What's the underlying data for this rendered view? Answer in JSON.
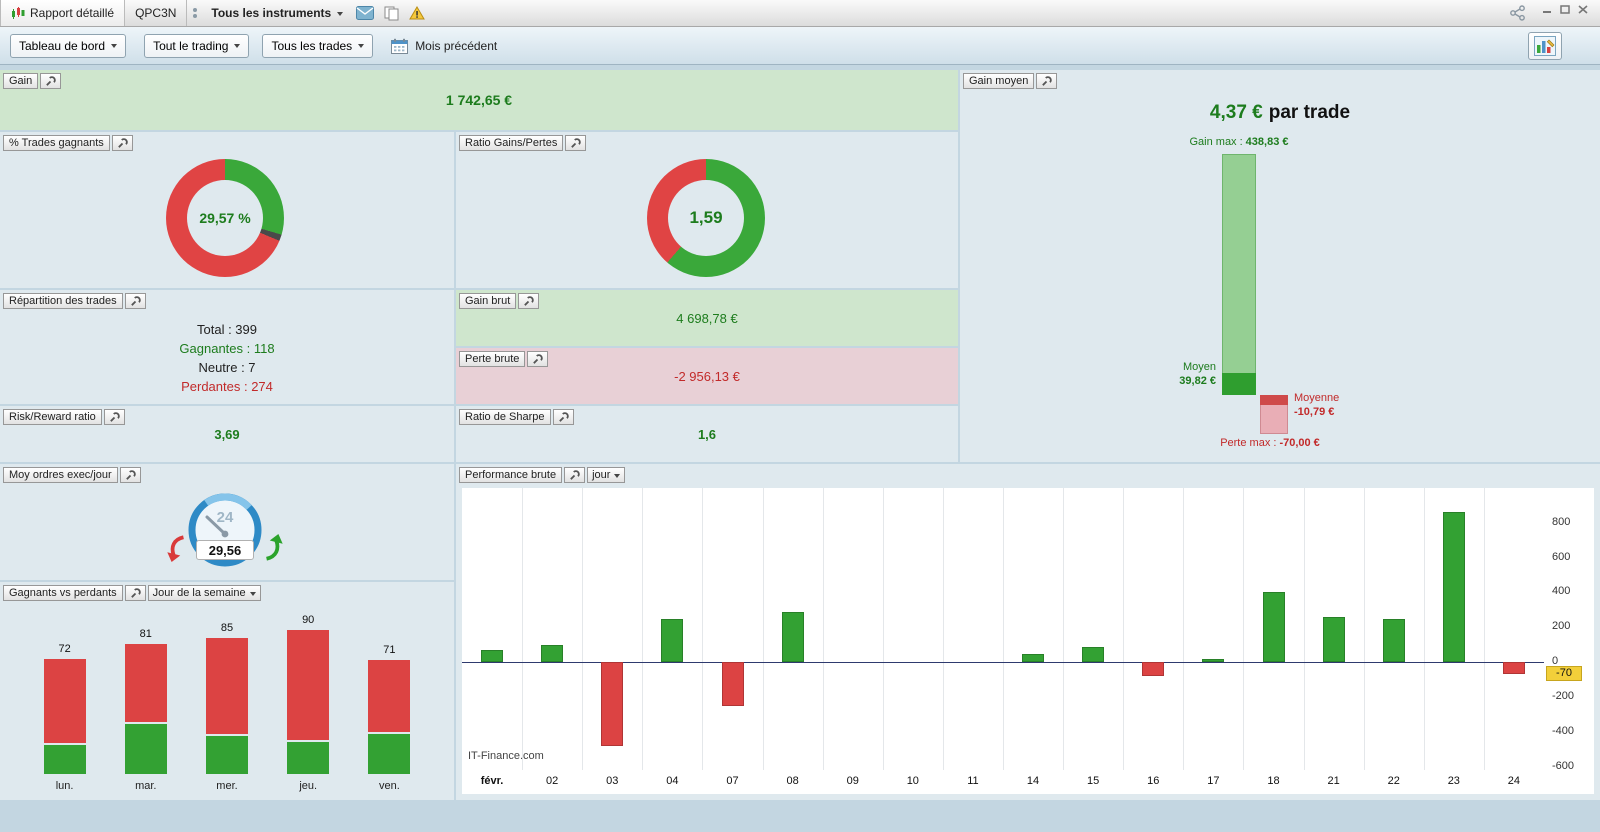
{
  "window": {
    "tabs": [
      {
        "label": "Rapport détaillé"
      },
      {
        "label": "QPC3N"
      }
    ],
    "instruments_dropdown": "Tous les instruments"
  },
  "toolbar": {
    "dashboard_dropdown": "Tableau de bord",
    "trading_scope_dropdown": "Tout le trading",
    "trades_filter_dropdown": "Tous les trades",
    "period_label": "Mois précédent"
  },
  "colors": {
    "text_green": "#1d7c1d",
    "text_red": "#c22a2a",
    "donut_green": "#3aa83a",
    "donut_red": "#e04444",
    "bar_green": "#33a133",
    "bar_red": "#dc4343",
    "panel_green_bg": "#cfe6cd",
    "panel_pink_bg": "#e8d0d6",
    "last_value_tag_bg": "#f2cf3a"
  },
  "panels": {
    "gain": {
      "label": "Gain",
      "value": "1 742,65 €"
    },
    "pct_trades_gagnants": {
      "label": "% Trades gagnants",
      "value": "29,57 %"
    },
    "ratio_gains_pertes": {
      "label": "Ratio Gains/Pertes",
      "value": "1,59"
    },
    "repartition_trades": {
      "label": "Répartition des trades",
      "rows": [
        {
          "name": "Total",
          "value": 399,
          "display": "Total : 399"
        },
        {
          "name": "Gagnantes",
          "value": 118,
          "display": "Gagnantes : 118"
        },
        {
          "name": "Neutre",
          "value": 7,
          "display": "Neutre : 7"
        },
        {
          "name": "Perdantes",
          "value": 274,
          "display": "Perdantes : 274"
        }
      ]
    },
    "gain_brut": {
      "label": "Gain brut",
      "value": "4 698,78 €"
    },
    "perte_brute": {
      "label": "Perte brute",
      "value": "-2 956,13 €"
    },
    "risk_reward": {
      "label": "Risk/Reward ratio",
      "value": "3,69"
    },
    "ratio_sharpe": {
      "label": "Ratio de Sharpe",
      "value": "1,6"
    },
    "moy_ordres": {
      "label": "Moy ordres exec/jour",
      "value": "29,56",
      "gauge_dial": "24"
    },
    "gagnants_vs_perdants": {
      "label": "Gagnants vs perdants",
      "dropdown": "Jour de la semaine"
    },
    "gain_moyen": {
      "label": "Gain moyen",
      "headline_value": "4,37 €",
      "headline_suffix": "par trade",
      "gain_max_label": "Gain max :",
      "gain_max_value": "438,83 €",
      "moyen_label": "Moyen",
      "moyen_value": "39,82 €",
      "moyenne_label": "Moyenne",
      "moyenne_value": "-10,79 €",
      "perte_max_label": "Perte max :",
      "perte_max_value": "-70,00 €"
    },
    "performance_brute": {
      "label": "Performance brute",
      "dropdown": "jour",
      "watermark": "IT-Finance.com",
      "last_value_tag": "-70"
    }
  },
  "chart_data": [
    {
      "name": "pct_trades_gagnants_donut",
      "type": "pie",
      "labels": [
        "Gagnantes",
        "Neutre",
        "Perdantes"
      ],
      "values": [
        29.57,
        1.75,
        68.68
      ],
      "colors": [
        "#3aa83a",
        "#4a4a4a",
        "#e04444"
      ],
      "center_text": "29,57 %"
    },
    {
      "name": "ratio_gains_pertes_donut",
      "type": "pie",
      "labels": [
        "Gains",
        "Pertes"
      ],
      "values": [
        61.4,
        38.6
      ],
      "colors": [
        "#3aa83a",
        "#e04444"
      ],
      "center_text": "1,59"
    },
    {
      "name": "gagnants_vs_perdants_bars",
      "type": "bar",
      "categories": [
        "lun.",
        "mar.",
        "mer.",
        "jeu.",
        "ven."
      ],
      "totals": [
        72,
        81,
        85,
        90,
        71
      ],
      "series": [
        {
          "name": "Gagnants",
          "color": "#33a133",
          "values": [
            18,
            31,
            24,
            20,
            25
          ]
        },
        {
          "name": "Perdants",
          "color": "#dc4343",
          "values": [
            54,
            50,
            61,
            70,
            46
          ]
        }
      ]
    },
    {
      "name": "gain_moyen_bars",
      "type": "bar",
      "gain_max": 438.83,
      "gain_moyen": 39.82,
      "perte_moyenne": -10.79,
      "perte_max": -70.0,
      "colors": {
        "gain_max": "#95cf93",
        "gain_moyen": "#2f9e2f",
        "perte_max": "#e9aeb6",
        "perte_moyenne": "#cf4a4a"
      }
    },
    {
      "name": "performance_brute_daily",
      "type": "bar",
      "title": "Performance brute (jour)",
      "categories": [
        "févr.",
        "02",
        "03",
        "04",
        "07",
        "08",
        "09",
        "10",
        "11",
        "14",
        "15",
        "16",
        "17",
        "18",
        "21",
        "22",
        "23",
        "24"
      ],
      "values": [
        70,
        100,
        -480,
        245,
        -250,
        290,
        0,
        0,
        0,
        45,
        85,
        -80,
        20,
        400,
        260,
        250,
        860,
        -70
      ],
      "ylabel_ticks": [
        800,
        600,
        400,
        200,
        0,
        -200,
        -400,
        -600
      ],
      "ylim": [
        -620,
        1000
      ],
      "positive_color": "#33a133",
      "negative_color": "#dc4343",
      "last_value": -70
    }
  ]
}
